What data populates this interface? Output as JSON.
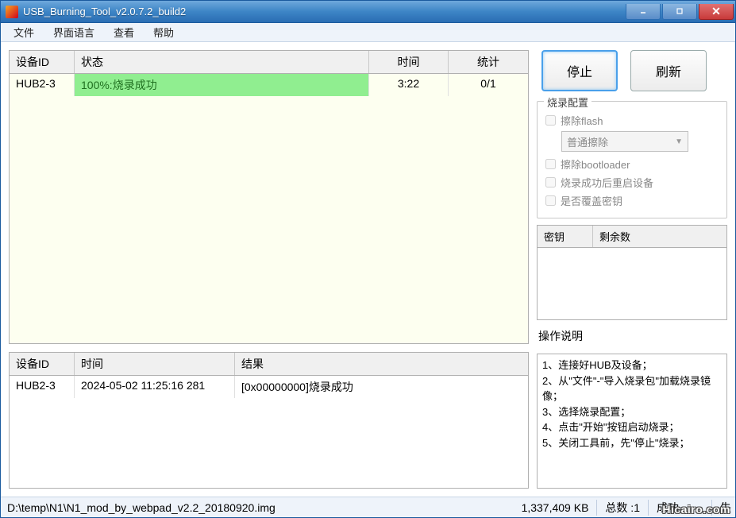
{
  "window": {
    "title": "USB_Burning_Tool_v2.0.7.2_build2"
  },
  "menu": {
    "file": "文件",
    "language": "界面语言",
    "view": "查看",
    "help": "帮助"
  },
  "grid1": {
    "headers": {
      "device": "设备ID",
      "status": "状态",
      "time": "时间",
      "stat": "统计"
    },
    "row": {
      "device": "HUB2-3",
      "status": "100%:烧录成功",
      "time": "3:22",
      "stat": "0/1"
    }
  },
  "grid2": {
    "headers": {
      "device": "设备ID",
      "time": "时间",
      "result": "结果"
    },
    "row": {
      "device": "HUB2-3",
      "time": "2024-05-02 11:25:16 281",
      "result": "[0x00000000]烧录成功"
    }
  },
  "buttons": {
    "stop": "停止",
    "refresh": "刷新"
  },
  "config": {
    "title": "烧录配置",
    "erase_flash": "擦除flash",
    "erase_mode": "普通擦除",
    "erase_bootloader": "擦除bootloader",
    "reboot_after": "烧录成功后重启设备",
    "overwrite_key": "是否覆盖密钥"
  },
  "keygrid": {
    "headers": {
      "key": "密钥",
      "remain": "剩余数"
    }
  },
  "ops": {
    "title": "操作说明",
    "s1": "1、连接好HUB及设备；",
    "s2": "2、从\"文件\"-\"导入烧录包\"加载烧录镜像；",
    "s3": "3、选择烧录配置；",
    "s4": "4、点击\"开始\"按钮启动烧录；",
    "s5": "5、关闭工具前，先\"停止\"烧录；"
  },
  "status": {
    "path": "D:\\temp\\N1\\N1_mod_by_webpad_v2.2_20180920.img",
    "size": "1,337,409 KB",
    "total_lbl": "总数 :",
    "total_val": "1",
    "success_lbl": "成功",
    "fail_lbl": "失"
  },
  "watermark": "Hicairo.com"
}
